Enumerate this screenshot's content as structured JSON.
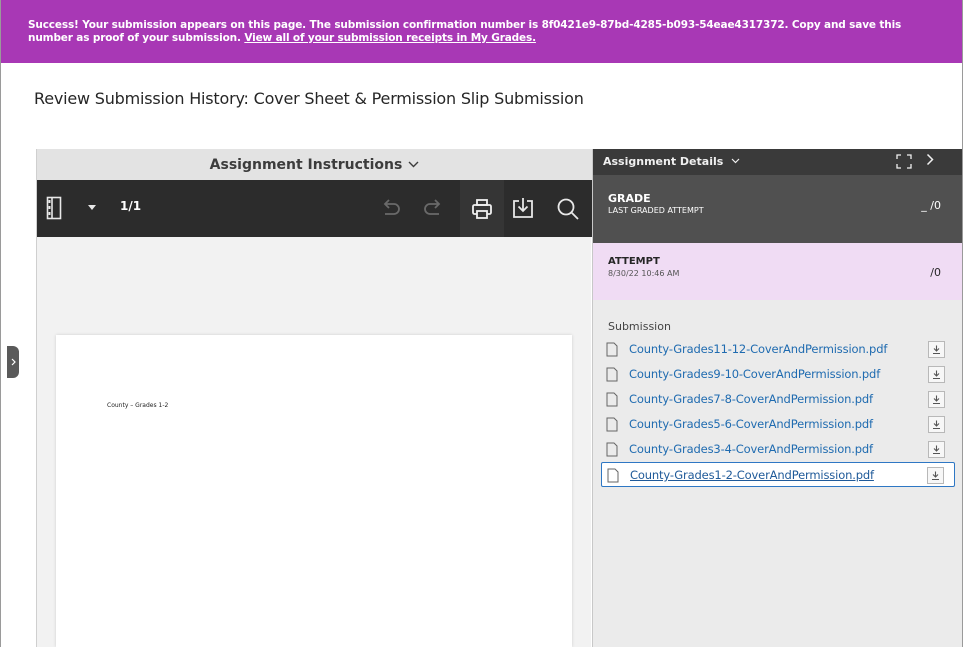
{
  "banner": {
    "message": "Success! Your submission appears on this page. The submission confirmation number is 8f0421e9-87bd-4285-b093-54eae4317372. Copy and save this number as proof of your submission.",
    "link_text": "View all of your submission receipts in My Grades."
  },
  "page": {
    "title": "Review Submission History: Cover Sheet & Permission Slip Submission"
  },
  "viewer": {
    "header_label": "Assignment Instructions",
    "page_count": "1/1",
    "document_text": "County – Grades 1-2"
  },
  "details": {
    "header_label": "Assignment Details",
    "grade": {
      "title": "GRADE",
      "subtitle": "LAST GRADED ATTEMPT",
      "score": "_ /0"
    },
    "attempt": {
      "title": "ATTEMPT",
      "date": "8/30/22 10:46 AM",
      "score": "/0"
    },
    "submission_label": "Submission",
    "files": [
      {
        "name": "County-Grades11-12-CoverAndPermission.pdf"
      },
      {
        "name": "County-Grades9-10-CoverAndPermission.pdf"
      },
      {
        "name": "County-Grades7-8-CoverAndPermission.pdf"
      },
      {
        "name": "County-Grades5-6-CoverAndPermission.pdf"
      },
      {
        "name": "County-Grades3-4-CoverAndPermission.pdf"
      },
      {
        "name": "County-Grades1-2-CoverAndPermission.pdf"
      }
    ]
  },
  "colors": {
    "banner_bg": "#a838b5",
    "toolbar_bg": "#2c2c2c",
    "grade_bg": "#505050",
    "attempt_bg": "#f0dcf4",
    "link": "#1f6bb0"
  },
  "icons": {
    "sidebar_toggle": "sidebar-toggle-icon",
    "dropdown": "caret-down-icon",
    "undo": "undo-icon",
    "redo": "redo-icon",
    "print": "print-icon",
    "download": "download-icon",
    "search": "search-icon",
    "expand": "expand-icon",
    "next": "chevron-right-icon",
    "file": "file-icon"
  }
}
